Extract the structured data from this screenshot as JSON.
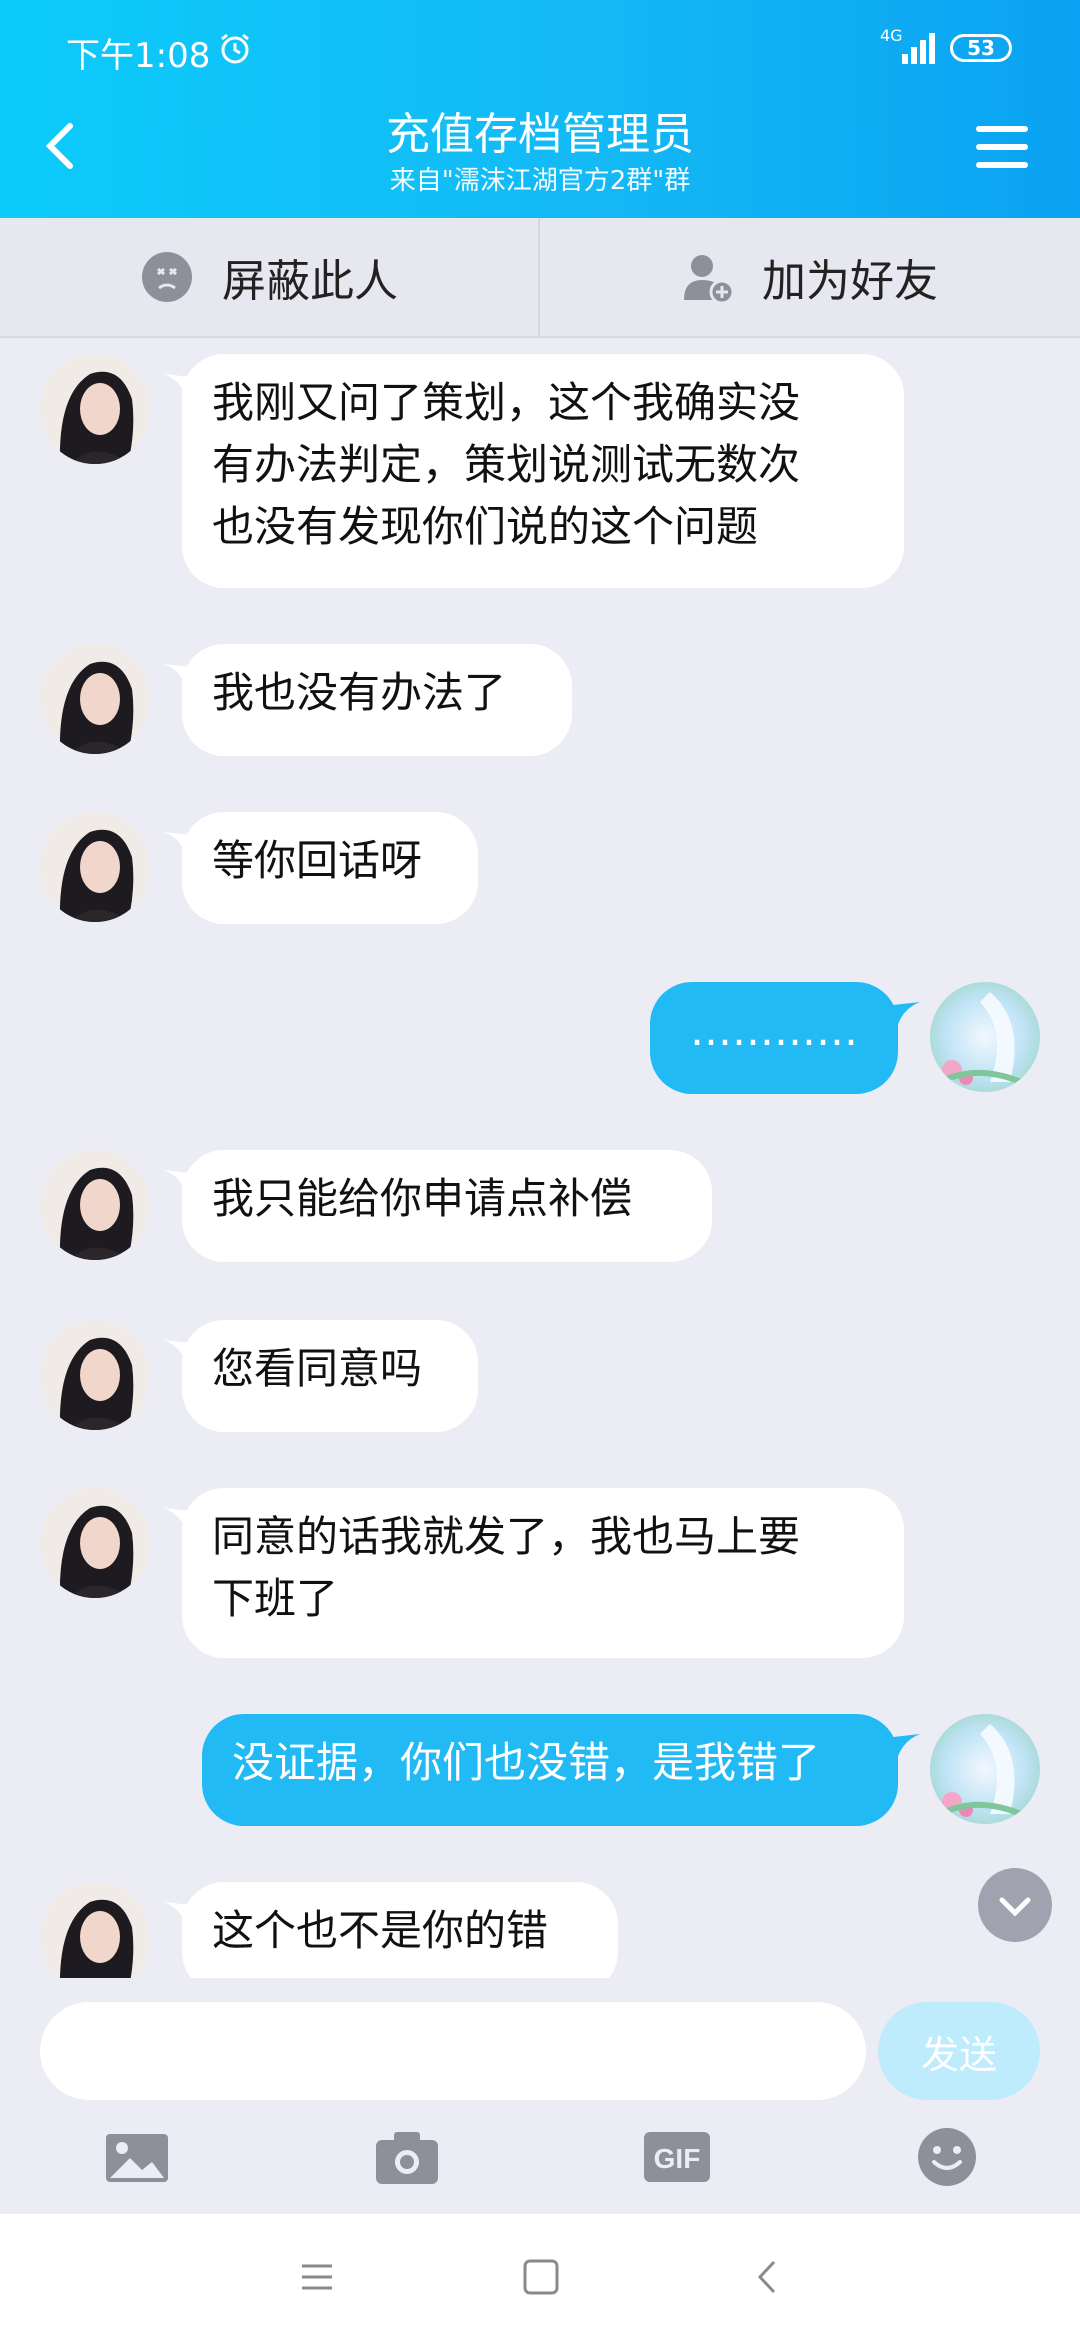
{
  "status_bar": {
    "time": "下午1:08",
    "network": "4G",
    "battery": "53"
  },
  "header": {
    "title": "充值存档管理员",
    "subtitle": "来自\"濡沫江湖官方2群\"群"
  },
  "actions": {
    "block_label": "屏蔽此人",
    "add_friend_label": "加为好友"
  },
  "messages": [
    {
      "side": "in",
      "lines": [
        "我刚又问了策划，这个我确实没",
        "有办法判定，策划说测试无数次",
        "也没有发现你们说的这个问题"
      ]
    },
    {
      "side": "in",
      "lines": [
        "我也没有办法了"
      ]
    },
    {
      "side": "in",
      "lines": [
        "等你回话呀"
      ]
    },
    {
      "side": "out",
      "lines": [
        "…………"
      ]
    },
    {
      "side": "in",
      "lines": [
        "我只能给你申请点补偿"
      ]
    },
    {
      "side": "in",
      "lines": [
        "您看同意吗"
      ]
    },
    {
      "side": "in",
      "lines": [
        "同意的话我就发了，我也马上要",
        "下班了"
      ]
    },
    {
      "side": "out",
      "lines": [
        "没证据，你们也没错，是我错了"
      ]
    },
    {
      "side": "in",
      "lines": [
        "这个也不是你的错"
      ]
    }
  ],
  "input": {
    "placeholder": "",
    "send_label": "发送"
  },
  "toolbar": [
    "image-icon",
    "camera-icon",
    "gif-icon",
    "emoji-icon"
  ],
  "colors": {
    "accent": "#21baf5",
    "header_start": "#0ccbfa",
    "header_end": "#0aa2f2",
    "background": "#ebecf4"
  }
}
